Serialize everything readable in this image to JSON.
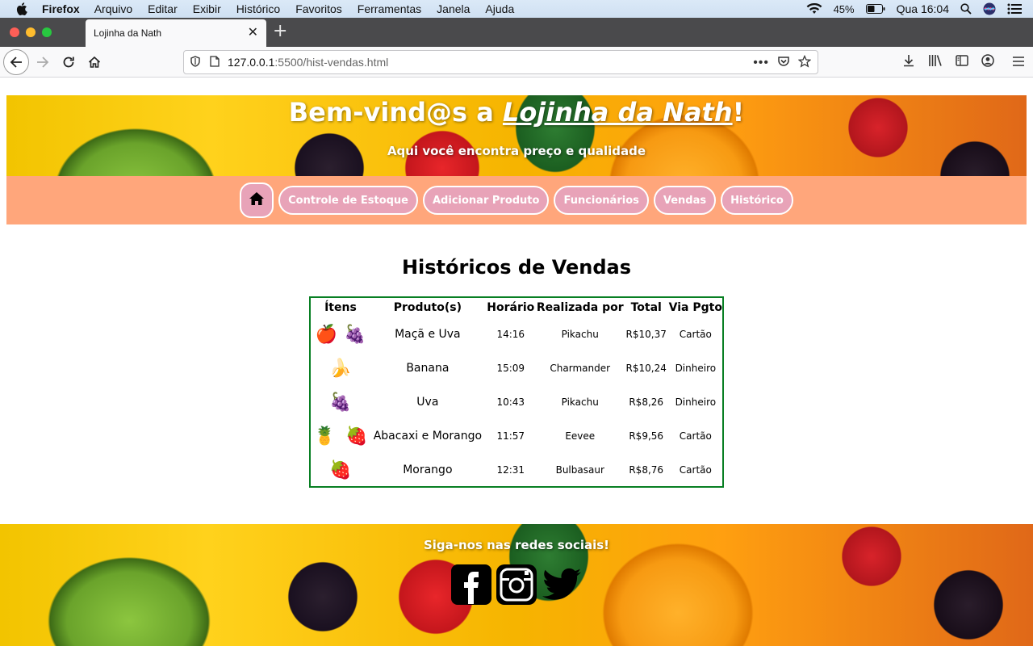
{
  "menubar": {
    "app": "Firefox",
    "items": [
      "Arquivo",
      "Editar",
      "Exibir",
      "Histórico",
      "Favoritos",
      "Ferramentas",
      "Janela",
      "Ajuda"
    ],
    "battery": "45%",
    "clock": "Qua 16:04"
  },
  "browser": {
    "tab_title": "Lojinha da Nath",
    "url_host": "127.0.0.1",
    "url_rest": ":5500/hist-vendas.html"
  },
  "header": {
    "title_prefix": "Bem-vind@s a ",
    "title_link": "Lojinha da Nath",
    "title_suffix": "!",
    "subtitle": "Aqui você encontra preço e qualidade"
  },
  "menu": {
    "items": [
      "Controle de Estoque",
      "Adicionar Produto",
      "Funcionários",
      "Vendas",
      "Histórico"
    ]
  },
  "main": {
    "title": "Históricos de Vendas",
    "table": {
      "headers": [
        "Ítens",
        "Produto(s)",
        "Horário",
        "Realizada por",
        "Total",
        "Via Pgto"
      ],
      "rows": [
        {
          "icons": [
            "🍎",
            "🍇"
          ],
          "produto": "Maçã e Uva",
          "horario": "14:16",
          "por": "Pikachu",
          "total": "R$10,37",
          "pgto": "Cartão"
        },
        {
          "icons": [
            "🍌"
          ],
          "produto": "Banana",
          "horario": "15:09",
          "por": "Charmander",
          "total": "R$10,24",
          "pgto": "Dinheiro"
        },
        {
          "icons": [
            "🍇"
          ],
          "produto": "Uva",
          "horario": "10:43",
          "por": "Pikachu",
          "total": "R$8,26",
          "pgto": "Dinheiro"
        },
        {
          "icons": [
            "🍍",
            "🍓"
          ],
          "produto": "Abacaxi e Morango",
          "horario": "11:57",
          "por": "Eevee",
          "total": "R$9,56",
          "pgto": "Cartão"
        },
        {
          "icons": [
            "🍓"
          ],
          "produto": "Morango",
          "horario": "12:31",
          "por": "Bulbasaur",
          "total": "R$8,76",
          "pgto": "Cartão"
        }
      ]
    }
  },
  "footer": {
    "follow_text": "Siga-nos nas redes sociais!",
    "social": [
      "facebook-icon",
      "instagram-icon",
      "twitter-icon"
    ]
  }
}
